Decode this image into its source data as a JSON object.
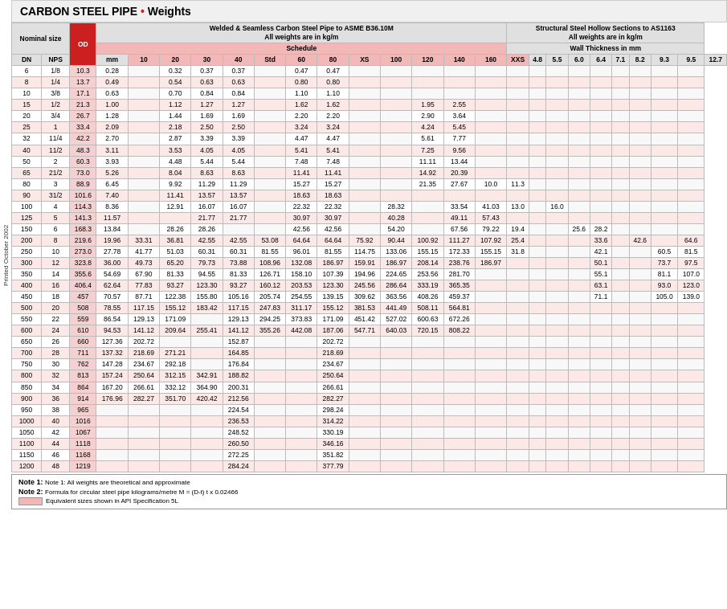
{
  "title": {
    "prefix": "CARBON STEEL PIPE",
    "bullet": " • ",
    "suffix": "Weights"
  },
  "side_label": "Printed October 2002",
  "headers": {
    "nominal_size": "Nominal size",
    "od": "OD",
    "welded_seamless": "Welded & Seamless Carbon Steel Pipe to ASME B36.10M",
    "welded_subtext": "All weights are in kg/m",
    "structural": "Structural Steel Hollow Sections to AS1163",
    "structural_subtext": "All weights are in kg/m",
    "schedule": "Schedule",
    "wall_thickness": "Wall Thickness in mm",
    "dn": "DN",
    "nps": "NPS",
    "mm": "mm",
    "sched_cols": [
      "10",
      "20",
      "30",
      "40",
      "Std",
      "60",
      "80",
      "XS",
      "100",
      "120",
      "140",
      "160",
      "XXS"
    ],
    "wall_cols": [
      "4.8",
      "5.5",
      "6.0",
      "6.4",
      "7.1",
      "8.2",
      "9.3",
      "9.5",
      "12.7"
    ]
  },
  "rows": [
    {
      "dn": "6",
      "nps": "1/8",
      "od": "10.3",
      "s10": "0.28",
      "s20": "",
      "s30": "0.32",
      "s40": "0.37",
      "std": "0.37",
      "s60": "",
      "s80": "0.47",
      "xs": "0.47",
      "s100": "",
      "s120": "",
      "s140": "",
      "s160": "",
      "xxs": "",
      "w48": "",
      "w55": "",
      "w60": "",
      "w64": "",
      "w71": "",
      "w82": "",
      "w93": "",
      "w95": "",
      "w127": ""
    },
    {
      "dn": "8",
      "nps": "1/4",
      "od": "13.7",
      "s10": "0.49",
      "s20": "",
      "s30": "0.54",
      "s40": "0.63",
      "std": "0.63",
      "s60": "",
      "s80": "0.80",
      "xs": "0.80",
      "s100": "",
      "s120": "",
      "s140": "",
      "s160": "",
      "xxs": "",
      "w48": "",
      "w55": "",
      "w60": "",
      "w64": "",
      "w71": "",
      "w82": "",
      "w93": "",
      "w95": "",
      "w127": ""
    },
    {
      "dn": "10",
      "nps": "3/8",
      "od": "17.1",
      "s10": "0.63",
      "s20": "",
      "s30": "0.70",
      "s40": "0.84",
      "std": "0.84",
      "s60": "",
      "s80": "1.10",
      "xs": "1.10",
      "s100": "",
      "s120": "",
      "s140": "",
      "s160": "",
      "xxs": "",
      "w48": "",
      "w55": "",
      "w60": "",
      "w64": "",
      "w71": "",
      "w82": "",
      "w93": "",
      "w95": "",
      "w127": ""
    },
    {
      "dn": "15",
      "nps": "1/2",
      "od": "21.3",
      "s10": "1.00",
      "s20": "",
      "s30": "1.12",
      "s40": "1.27",
      "std": "1.27",
      "s60": "",
      "s80": "1.62",
      "xs": "1.62",
      "s100": "",
      "s120": "",
      "s140": "1.95",
      "s160": "2.55",
      "xxs": "",
      "w48": "",
      "w55": "",
      "w60": "",
      "w64": "",
      "w71": "",
      "w82": "",
      "w93": "",
      "w95": "",
      "w127": ""
    },
    {
      "dn": "20",
      "nps": "3/4",
      "od": "26.7",
      "s10": "1.28",
      "s20": "",
      "s30": "1.44",
      "s40": "1.69",
      "std": "1.69",
      "s60": "",
      "s80": "2.20",
      "xs": "2.20",
      "s100": "",
      "s120": "",
      "s140": "2.90",
      "s160": "3.64",
      "xxs": "",
      "w48": "",
      "w55": "",
      "w60": "",
      "w64": "",
      "w71": "",
      "w82": "",
      "w93": "",
      "w95": "",
      "w127": ""
    },
    {
      "dn": "25",
      "nps": "1",
      "od": "33.4",
      "s10": "2.09",
      "s20": "",
      "s30": "2.18",
      "s40": "2.50",
      "std": "2.50",
      "s60": "",
      "s80": "3.24",
      "xs": "3.24",
      "s100": "",
      "s120": "",
      "s140": "4.24",
      "s160": "5.45",
      "xxs": "",
      "w48": "",
      "w55": "",
      "w60": "",
      "w64": "",
      "w71": "",
      "w82": "",
      "w93": "",
      "w95": "",
      "w127": ""
    },
    {
      "dn": "32",
      "nps": "11/4",
      "od": "42.2",
      "s10": "2.70",
      "s20": "",
      "s30": "2.87",
      "s40": "3.39",
      "std": "3.39",
      "s60": "",
      "s80": "4.47",
      "xs": "4.47",
      "s100": "",
      "s120": "",
      "s140": "5.61",
      "s160": "7.77",
      "xxs": "",
      "w48": "",
      "w55": "",
      "w60": "",
      "w64": "",
      "w71": "",
      "w82": "",
      "w93": "",
      "w95": "",
      "w127": ""
    },
    {
      "dn": "40",
      "nps": "11/2",
      "od": "48.3",
      "s10": "3.11",
      "s20": "",
      "s30": "3.53",
      "s40": "4.05",
      "std": "4.05",
      "s60": "",
      "s80": "5.41",
      "xs": "5.41",
      "s100": "",
      "s120": "",
      "s140": "7.25",
      "s160": "9.56",
      "xxs": "",
      "w48": "",
      "w55": "",
      "w60": "",
      "w64": "",
      "w71": "",
      "w82": "",
      "w93": "",
      "w95": "",
      "w127": ""
    },
    {
      "dn": "50",
      "nps": "2",
      "od": "60.3",
      "s10": "3.93",
      "s20": "",
      "s30": "4.48",
      "s40": "5.44",
      "std": "5.44",
      "s60": "",
      "s80": "7.48",
      "xs": "7.48",
      "s100": "",
      "s120": "",
      "s140": "11.11",
      "s160": "13.44",
      "xxs": "",
      "w48": "",
      "w55": "",
      "w60": "",
      "w64": "",
      "w71": "",
      "w82": "",
      "w93": "",
      "w95": "",
      "w127": ""
    },
    {
      "dn": "65",
      "nps": "21/2",
      "od": "73.0",
      "s10": "5.26",
      "s20": "",
      "s30": "8.04",
      "s40": "8.63",
      "std": "8.63",
      "s60": "",
      "s80": "11.41",
      "xs": "11.41",
      "s100": "",
      "s120": "",
      "s140": "14.92",
      "s160": "20.39",
      "xxs": "",
      "w48": "",
      "w55": "",
      "w60": "",
      "w64": "",
      "w71": "",
      "w82": "",
      "w93": "",
      "w95": "",
      "w127": ""
    },
    {
      "dn": "80",
      "nps": "3",
      "od": "88.9",
      "s10": "6.45",
      "s20": "",
      "s30": "9.92",
      "s40": "11.29",
      "std": "11.29",
      "s60": "",
      "s80": "15.27",
      "xs": "15.27",
      "s100": "",
      "s120": "",
      "s140": "21.35",
      "s160": "27.67",
      "xxs": "10.0",
      "w48": "11.3",
      "w55": "",
      "w60": "",
      "w64": "",
      "w71": "",
      "w82": "",
      "w93": "",
      "w95": "",
      "w127": ""
    },
    {
      "dn": "90",
      "nps": "31/2",
      "od": "101.6",
      "s10": "7.40",
      "s20": "",
      "s30": "11.41",
      "s40": "13.57",
      "std": "13.57",
      "s60": "",
      "s80": "18.63",
      "xs": "18.63",
      "s100": "",
      "s120": "",
      "s140": "",
      "s160": "",
      "xxs": "",
      "w48": "",
      "w55": "",
      "w60": "",
      "w64": "",
      "w71": "",
      "w82": "",
      "w93": "",
      "w95": "",
      "w127": ""
    },
    {
      "dn": "100",
      "nps": "4",
      "od": "114.3",
      "s10": "8.36",
      "s20": "",
      "s30": "12.91",
      "s40": "16.07",
      "std": "16.07",
      "s60": "",
      "s80": "22.32",
      "xs": "22.32",
      "s100": "",
      "s120": "28.32",
      "s140": "",
      "s160": "33.54",
      "xxs": "41.03",
      "w48": "13.0",
      "w55": "",
      "w60": "16.0",
      "w64": "",
      "w71": "",
      "w82": "",
      "w93": "",
      "w95": "",
      "w127": ""
    },
    {
      "dn": "125",
      "nps": "5",
      "od": "141.3",
      "s10": "11.57",
      "s20": "",
      "s30": "",
      "s40": "21.77",
      "std": "21.77",
      "s60": "",
      "s80": "30.97",
      "xs": "30.97",
      "s100": "",
      "s120": "40.28",
      "s140": "",
      "s160": "49.11",
      "xxs": "57.43",
      "w48": "",
      "w55": "",
      "w60": "",
      "w64": "",
      "w71": "",
      "w82": "",
      "w93": "",
      "w95": "",
      "w127": ""
    },
    {
      "dn": "150",
      "nps": "6",
      "od": "168.3",
      "s10": "13.84",
      "s20": "",
      "s30": "28.26",
      "s40": "28.26",
      "std": "",
      "s60": "",
      "s80": "42.56",
      "xs": "42.56",
      "s100": "",
      "s120": "54.20",
      "s140": "",
      "s160": "67.56",
      "xxs": "79.22",
      "w48": "19.4",
      "w55": "",
      "w60": "",
      "w64": "25.6",
      "w71": "28.2",
      "w82": "",
      "w93": "",
      "w95": "",
      "w127": ""
    },
    {
      "dn": "200",
      "nps": "8",
      "od": "219.6",
      "s10": "19.96",
      "s20": "33.31",
      "s30": "36.81",
      "s40": "42.55",
      "std": "42.55",
      "s60": "53.08",
      "s80": "64.64",
      "xs": "64.64",
      "s100": "75.92",
      "s120": "90.44",
      "s140": "100.92",
      "s160": "111.27",
      "xxs": "107.92",
      "w48": "25.4",
      "w55": "",
      "w60": "",
      "w64": "",
      "w71": "33.6",
      "w82": "",
      "w93": "42.6",
      "w95": "",
      "w127": "64.6"
    },
    {
      "dn": "250",
      "nps": "10",
      "od": "273.0",
      "s10": "27.78",
      "s20": "41.77",
      "s30": "51.03",
      "s40": "60.31",
      "std": "60.31",
      "s60": "81.55",
      "s80": "96.01",
      "xs": "81.55",
      "s100": "114.75",
      "s120": "133.06",
      "s140": "155.15",
      "s160": "172.33",
      "xxs": "155.15",
      "w48": "31.8",
      "w55": "",
      "w60": "",
      "w64": "",
      "w71": "42.1",
      "w82": "",
      "w93": "",
      "w95": "60.5",
      "w127": "81.5"
    },
    {
      "dn": "300",
      "nps": "12",
      "od": "323.8",
      "s10": "36.00",
      "s20": "49.73",
      "s30": "65.20",
      "s40": "79.73",
      "std": "73.88",
      "s60": "108.96",
      "s80": "132.08",
      "xs": "186.97",
      "s100": "159.91",
      "s120": "186.97",
      "s140": "208.14",
      "s160": "238.76",
      "xxs": "186.97",
      "w48": "",
      "w55": "",
      "w60": "",
      "w64": "",
      "w71": "50.1",
      "w82": "",
      "w93": "",
      "w95": "73.7",
      "w127": "97.5"
    },
    {
      "dn": "350",
      "nps": "14",
      "od": "355.6",
      "s10": "54.69",
      "s20": "67.90",
      "s30": "81.33",
      "s40": "94.55",
      "std": "81.33",
      "s60": "126.71",
      "s80": "158.10",
      "xs": "107.39",
      "s100": "194.96",
      "s120": "224.65",
      "s140": "253.56",
      "s160": "281.70",
      "xxs": "",
      "w48": "",
      "w55": "",
      "w60": "",
      "w64": "",
      "w71": "55.1",
      "w82": "",
      "w93": "",
      "w95": "81.1",
      "w127": "107.0"
    },
    {
      "dn": "400",
      "nps": "16",
      "od": "406.4",
      "s10": "62.64",
      "s20": "77.83",
      "s30": "93.27",
      "s40": "123.30",
      "std": "93.27",
      "s60": "160.12",
      "s80": "203.53",
      "xs": "123.30",
      "s100": "245.56",
      "s120": "286.64",
      "s140": "333.19",
      "s160": "365.35",
      "xxs": "",
      "w48": "",
      "w55": "",
      "w60": "",
      "w64": "",
      "w71": "63.1",
      "w82": "",
      "w93": "",
      "w95": "93.0",
      "w127": "123.0"
    },
    {
      "dn": "450",
      "nps": "18",
      "od": "457",
      "s10": "70.57",
      "s20": "87.71",
      "s30": "122.38",
      "s40": "155.80",
      "std": "105.16",
      "s60": "205.74",
      "s80": "254.55",
      "xs": "139.15",
      "s100": "309.62",
      "s120": "363.56",
      "s140": "408.26",
      "s160": "459.37",
      "xxs": "",
      "w48": "",
      "w55": "",
      "w60": "",
      "w64": "",
      "w71": "71.1",
      "w82": "",
      "w93": "",
      "w95": "105.0",
      "w127": "139.0"
    },
    {
      "dn": "500",
      "nps": "20",
      "od": "508",
      "s10": "78.55",
      "s20": "117.15",
      "s30": "155.12",
      "s40": "183.42",
      "std": "117.15",
      "s60": "247.83",
      "s80": "311.17",
      "xs": "155.12",
      "s100": "381.53",
      "s120": "441.49",
      "s140": "508.11",
      "s160": "564.81",
      "xxs": "",
      "w48": "",
      "w55": "",
      "w60": "",
      "w64": "",
      "w71": "",
      "w82": "",
      "w93": "",
      "w95": "",
      "w127": ""
    },
    {
      "dn": "550",
      "nps": "22",
      "od": "559",
      "s10": "86.54",
      "s20": "129.13",
      "s30": "171.09",
      "s40": "",
      "std": "129.13",
      "s60": "294.25",
      "s80": "373.83",
      "xs": "171.09",
      "s100": "451.42",
      "s120": "527.02",
      "s140": "600.63",
      "s160": "672.26",
      "xxs": "",
      "w48": "",
      "w55": "",
      "w60": "",
      "w64": "",
      "w71": "",
      "w82": "",
      "w93": "",
      "w95": "",
      "w127": ""
    },
    {
      "dn": "600",
      "nps": "24",
      "od": "610",
      "s10": "94.53",
      "s20": "141.12",
      "s30": "209.64",
      "s40": "255.41",
      "std": "141.12",
      "s60": "355.26",
      "s80": "442.08",
      "xs": "187.06",
      "s100": "547.71",
      "s120": "640.03",
      "s140": "720.15",
      "s160": "808.22",
      "xxs": "",
      "w48": "",
      "w55": "",
      "w60": "",
      "w64": "",
      "w71": "",
      "w82": "",
      "w93": "",
      "w95": "",
      "w127": ""
    },
    {
      "dn": "650",
      "nps": "26",
      "od": "660",
      "s10": "127.36",
      "s20": "202.72",
      "s30": "",
      "s40": "",
      "std": "152.87",
      "s60": "",
      "s80": "",
      "xs": "202.72",
      "s100": "",
      "s120": "",
      "s140": "",
      "s160": "",
      "xxs": "",
      "w48": "",
      "w55": "",
      "w60": "",
      "w64": "",
      "w71": "",
      "w82": "",
      "w93": "",
      "w95": "",
      "w127": ""
    },
    {
      "dn": "700",
      "nps": "28",
      "od": "711",
      "s10": "137.32",
      "s20": "218.69",
      "s30": "271.21",
      "s40": "",
      "std": "164.85",
      "s60": "",
      "s80": "",
      "xs": "218.69",
      "s100": "",
      "s120": "",
      "s140": "",
      "s160": "",
      "xxs": "",
      "w48": "",
      "w55": "",
      "w60": "",
      "w64": "",
      "w71": "",
      "w82": "",
      "w93": "",
      "w95": "",
      "w127": ""
    },
    {
      "dn": "750",
      "nps": "30",
      "od": "762",
      "s10": "147.28",
      "s20": "234.67",
      "s30": "292.18",
      "s40": "",
      "std": "176.84",
      "s60": "",
      "s80": "",
      "xs": "234.67",
      "s100": "",
      "s120": "",
      "s140": "",
      "s160": "",
      "xxs": "",
      "w48": "",
      "w55": "",
      "w60": "",
      "w64": "",
      "w71": "",
      "w82": "",
      "w93": "",
      "w95": "",
      "w127": ""
    },
    {
      "dn": "800",
      "nps": "32",
      "od": "813",
      "s10": "157.24",
      "s20": "250.64",
      "s30": "312.15",
      "s40": "342.91",
      "std": "188.82",
      "s60": "",
      "s80": "",
      "xs": "250.64",
      "s100": "",
      "s120": "",
      "s140": "",
      "s160": "",
      "xxs": "",
      "w48": "",
      "w55": "",
      "w60": "",
      "w64": "",
      "w71": "",
      "w82": "",
      "w93": "",
      "w95": "",
      "w127": ""
    },
    {
      "dn": "850",
      "nps": "34",
      "od": "864",
      "s10": "167.20",
      "s20": "266.61",
      "s30": "332.12",
      "s40": "364.90",
      "std": "200.31",
      "s60": "",
      "s80": "",
      "xs": "266.61",
      "s100": "",
      "s120": "",
      "s140": "",
      "s160": "",
      "xxs": "",
      "w48": "",
      "w55": "",
      "w60": "",
      "w64": "",
      "w71": "",
      "w82": "",
      "w93": "",
      "w95": "",
      "w127": ""
    },
    {
      "dn": "900",
      "nps": "36",
      "od": "914",
      "s10": "176.96",
      "s20": "282.27",
      "s30": "351.70",
      "s40": "420.42",
      "std": "212.56",
      "s60": "",
      "s80": "",
      "xs": "282.27",
      "s100": "",
      "s120": "",
      "s140": "",
      "s160": "",
      "xxs": "",
      "w48": "",
      "w55": "",
      "w60": "",
      "w64": "",
      "w71": "",
      "w82": "",
      "w93": "",
      "w95": "",
      "w127": ""
    },
    {
      "dn": "950",
      "nps": "38",
      "od": "965",
      "s10": "",
      "s20": "",
      "s30": "",
      "s40": "",
      "std": "224.54",
      "s60": "",
      "s80": "",
      "xs": "298.24",
      "s100": "",
      "s120": "",
      "s140": "",
      "s160": "",
      "xxs": "",
      "w48": "",
      "w55": "",
      "w60": "",
      "w64": "",
      "w71": "",
      "w82": "",
      "w93": "",
      "w95": "",
      "w127": ""
    },
    {
      "dn": "1000",
      "nps": "40",
      "od": "1016",
      "s10": "",
      "s20": "",
      "s30": "",
      "s40": "",
      "std": "236.53",
      "s60": "",
      "s80": "",
      "xs": "314.22",
      "s100": "",
      "s120": "",
      "s140": "",
      "s160": "",
      "xxs": "",
      "w48": "",
      "w55": "",
      "w60": "",
      "w64": "",
      "w71": "",
      "w82": "",
      "w93": "",
      "w95": "",
      "w127": ""
    },
    {
      "dn": "1050",
      "nps": "42",
      "od": "1067",
      "s10": "",
      "s20": "",
      "s30": "",
      "s40": "",
      "std": "248.52",
      "s60": "",
      "s80": "",
      "xs": "330.19",
      "s100": "",
      "s120": "",
      "s140": "",
      "s160": "",
      "xxs": "",
      "w48": "",
      "w55": "",
      "w60": "",
      "w64": "",
      "w71": "",
      "w82": "",
      "w93": "",
      "w95": "",
      "w127": ""
    },
    {
      "dn": "1100",
      "nps": "44",
      "od": "1118",
      "s10": "",
      "s20": "",
      "s30": "",
      "s40": "",
      "std": "260.50",
      "s60": "",
      "s80": "",
      "xs": "346.16",
      "s100": "",
      "s120": "",
      "s140": "",
      "s160": "",
      "xxs": "",
      "w48": "",
      "w55": "",
      "w60": "",
      "w64": "",
      "w71": "",
      "w82": "",
      "w93": "",
      "w95": "",
      "w127": ""
    },
    {
      "dn": "1150",
      "nps": "46",
      "od": "1168",
      "s10": "",
      "s20": "",
      "s30": "",
      "s40": "",
      "std": "272.25",
      "s60": "",
      "s80": "",
      "xs": "351.82",
      "s100": "",
      "s120": "",
      "s140": "",
      "s160": "",
      "xxs": "",
      "w48": "",
      "w55": "",
      "w60": "",
      "w64": "",
      "w71": "",
      "w82": "",
      "w93": "",
      "w95": "",
      "w127": ""
    },
    {
      "dn": "1200",
      "nps": "48",
      "od": "1219",
      "s10": "",
      "s20": "",
      "s30": "",
      "s40": "",
      "std": "284.24",
      "s60": "",
      "s80": "",
      "xs": "377.79",
      "s100": "",
      "s120": "",
      "s140": "",
      "s160": "",
      "xxs": "",
      "w48": "",
      "w55": "",
      "w60": "",
      "w64": "",
      "w71": "",
      "w82": "",
      "w93": "",
      "w95": "",
      "w127": ""
    }
  ],
  "notes": {
    "note1": "Note 1: All weights are theoretical and approximate",
    "note2": "Note 2: Formula for circular steel pipe kilograms/metre M = (D-t) t x 0.02466",
    "note3_label": "Equivalent sizes shown in API Specification 5L"
  }
}
